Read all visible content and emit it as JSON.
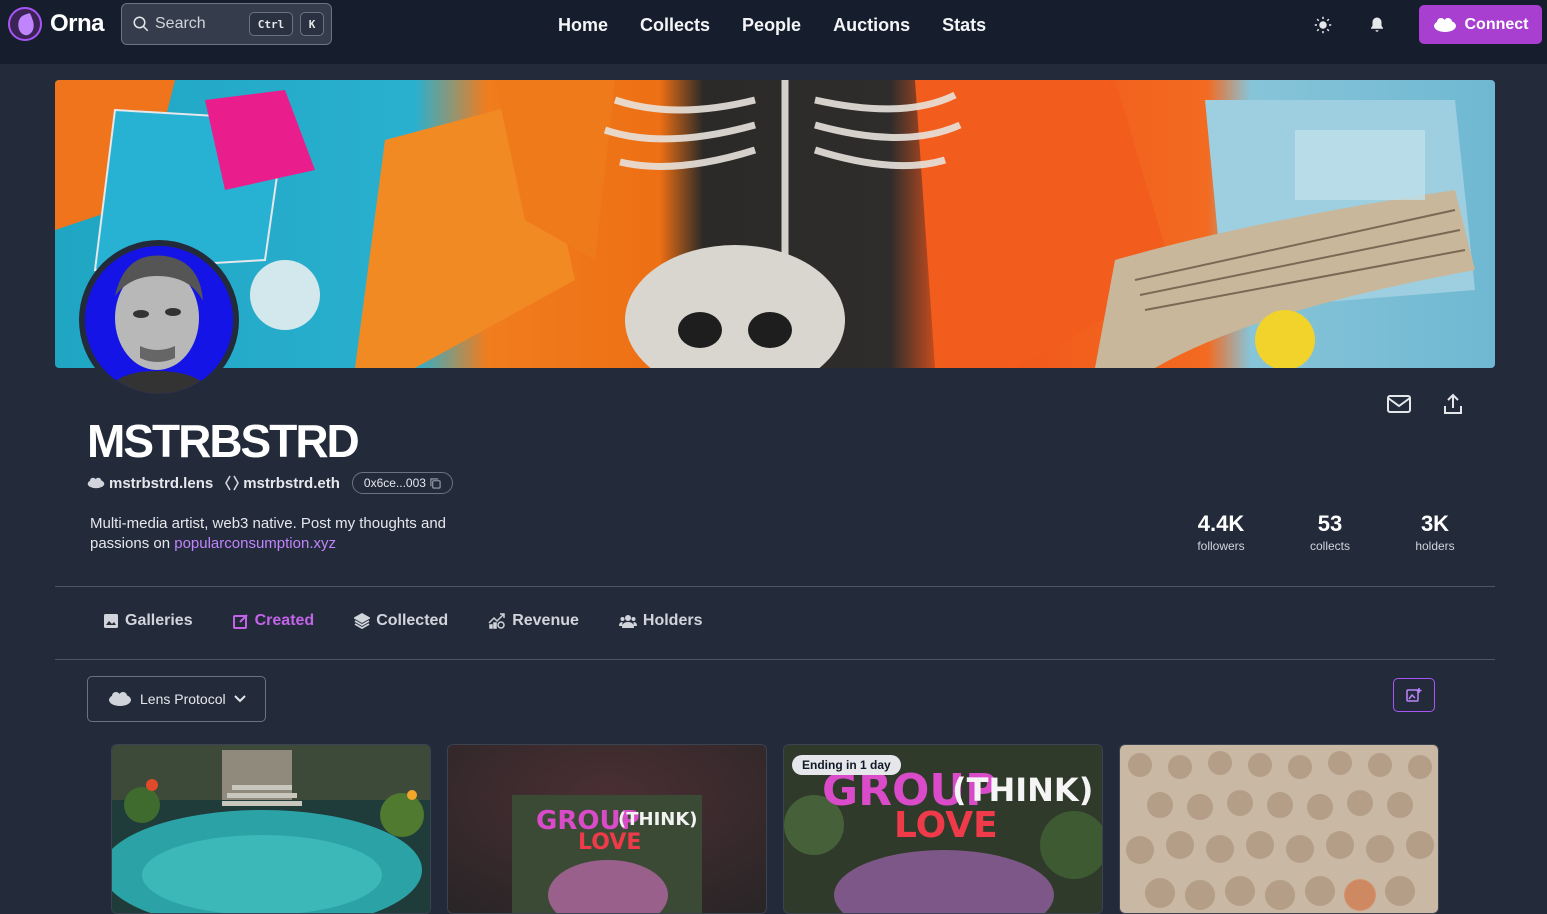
{
  "app": {
    "name": "Orna"
  },
  "search": {
    "placeholder": "Search",
    "kbd_ctrl": "Ctrl",
    "kbd_key": "K"
  },
  "nav": [
    {
      "label": "Home"
    },
    {
      "label": "Collects"
    },
    {
      "label": "People"
    },
    {
      "label": "Auctions"
    },
    {
      "label": "Stats"
    }
  ],
  "header": {
    "connect_label": "Connect",
    "theme_icon": "sun-icon",
    "notify_icon": "bell-icon"
  },
  "profile": {
    "name": "MSTRBSTRD",
    "lens_handle": "mstrbstrd.lens",
    "ens_handle": "mstrbstrd.eth",
    "address": "0x6ce...003",
    "bio_text": "Multi-media artist, web3 native. Post my thoughts and passions on ",
    "bio_link": "popularconsumption.xyz"
  },
  "stats": [
    {
      "value": "4.4K",
      "label": "followers"
    },
    {
      "value": "53",
      "label": "collects"
    },
    {
      "value": "3K",
      "label": "holders"
    }
  ],
  "tabs": [
    {
      "label": "Galleries",
      "icon": "image-icon"
    },
    {
      "label": "Created",
      "icon": "edit-icon",
      "active": true
    },
    {
      "label": "Collected",
      "icon": "layers-icon"
    },
    {
      "label": "Revenue",
      "icon": "revenue-chart-icon"
    },
    {
      "label": "Holders",
      "icon": "users-icon"
    }
  ],
  "filter": {
    "selected": "Lens Protocol"
  },
  "cards": [
    {
      "badge": ""
    },
    {
      "badge": ""
    },
    {
      "badge": "Ending in 1 day"
    },
    {
      "badge": ""
    }
  ],
  "colors": {
    "accent": "#a83fd0",
    "active_tab": "#c263e8",
    "background": "#232b3b",
    "topbar": "#161e2e"
  }
}
